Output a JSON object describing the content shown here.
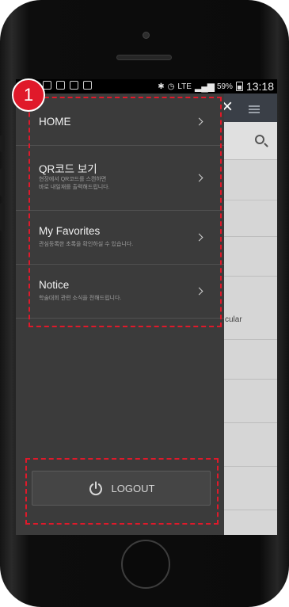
{
  "status_bar": {
    "battery": "59%",
    "time": "13:18",
    "network": "LTE"
  },
  "menu": {
    "items": [
      {
        "label": "HOME",
        "subtitle": ""
      },
      {
        "label": "QR코드 보기",
        "subtitle": "현장에서 QR코드를 스캔하면\n바로 내일재를 출력해드립니다."
      },
      {
        "label": "My Favorites",
        "subtitle": "관심등록한 초록을 확인하실 수 있습니다."
      },
      {
        "label": "Notice",
        "subtitle": "학술대회 관련 소식을 전해드립니다."
      }
    ]
  },
  "logout": {
    "label": "LOGOUT"
  },
  "app_background": {
    "visible_text": "cular"
  },
  "annotation": {
    "badge": "1",
    "color": "#e0192a"
  },
  "icons": [
    "power-icon",
    "chevron-right-icon",
    "close-icon",
    "hamburger-icon",
    "search-icon"
  ]
}
